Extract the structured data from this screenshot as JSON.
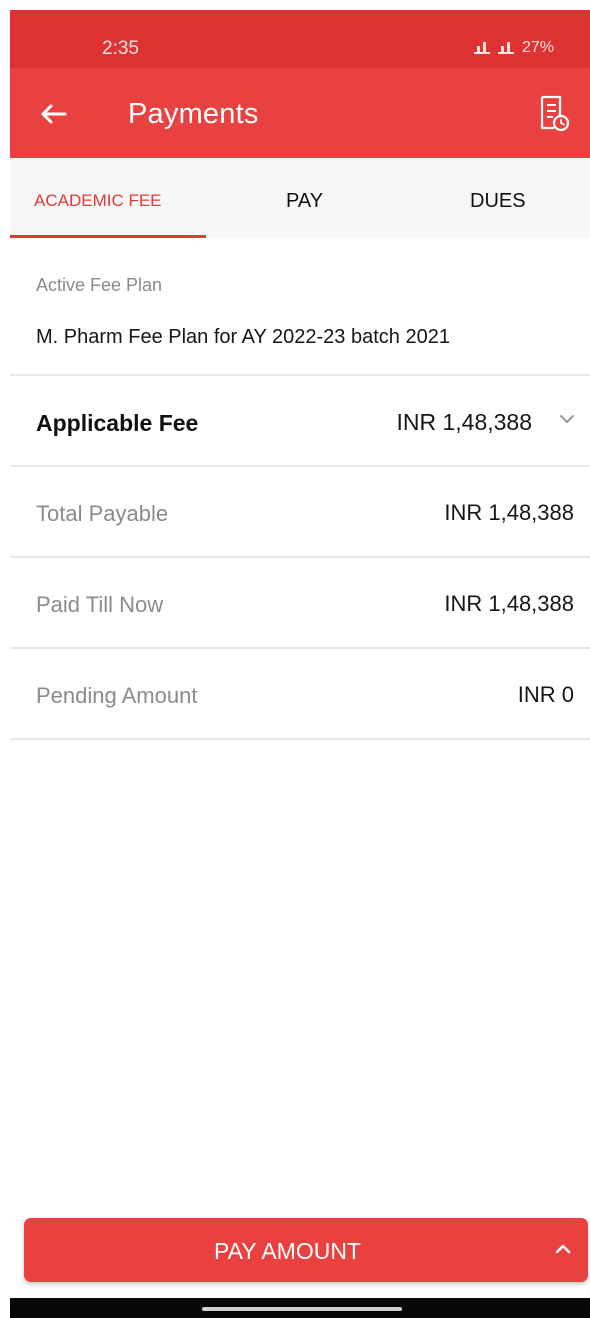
{
  "status_bar": {
    "time": "2:35",
    "battery": "27%"
  },
  "app_bar": {
    "title": "Payments",
    "back_icon": "arrow-left-icon",
    "action_icon": "receipt-icon"
  },
  "tabs": [
    {
      "label": "ACADEMIC FEE",
      "selected": true
    },
    {
      "label": "PAY",
      "selected": false
    },
    {
      "label": "DUES",
      "selected": false
    }
  ],
  "fee_plan": {
    "label": "Active Fee Plan",
    "value": "M. Pharm Fee Plan for AY 2022-23 batch 2021"
  },
  "rows": {
    "applicable": {
      "label": "Applicable Fee",
      "amount": "INR 1,48,388"
    },
    "total_payable": {
      "label": "Total Payable",
      "amount": "INR 1,48,388"
    },
    "paid_till_now": {
      "label": "Paid Till Now",
      "amount": "INR 1,48,388"
    },
    "pending": {
      "label": "Pending Amount",
      "amount": "INR 0"
    }
  },
  "footer": {
    "pay_button": "PAY AMOUNT"
  },
  "colors": {
    "accent": "#e8413f",
    "status_bar": "#dd3333",
    "tab_background": "#f7f7f7",
    "divider": "#e8e8e8"
  }
}
